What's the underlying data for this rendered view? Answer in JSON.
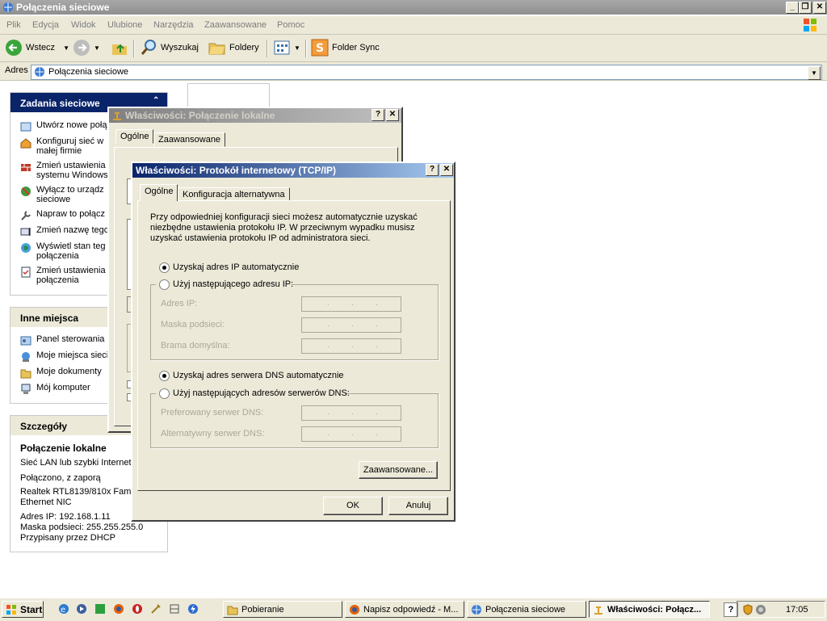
{
  "window": {
    "title": "Połączenia sieciowe"
  },
  "menu": [
    "Plik",
    "Edycja",
    "Widok",
    "Ulubione",
    "Narzędzia",
    "Zaawansowane",
    "Pomoc"
  ],
  "toolbar": {
    "back": "Wstecz",
    "search": "Wyszukaj",
    "folders": "Foldery",
    "folder_sync": "Folder Sync"
  },
  "address": {
    "label": "Adres",
    "value": "Połączenia sieciowe"
  },
  "tasks": {
    "header": "Zadania sieciowe",
    "items": [
      "Utwórz nowe połą",
      "Konfiguruj sieć w\nmałej firmie",
      "Zmień ustawienia\nsystemu Windows",
      "Wyłącz to urządz\nsieciowe",
      "Napraw to połącz",
      "Zmień nazwę tego",
      "Wyświetl stan teg\npołączenia",
      "Zmień ustawienia\npołączenia"
    ]
  },
  "other_places": {
    "header": "Inne miejsca",
    "items": [
      "Panel sterowania",
      "Moje miejsca sieci",
      "Moje dokumenty",
      "Mój komputer"
    ]
  },
  "details": {
    "header": "Szczegóły",
    "name": "Połączenie lokalne",
    "lines": [
      "Sieć LAN lub szybki Internet",
      "Połączono, z zaporą",
      "Realtek RTL8139/810x Famil\nEthernet NIC",
      "Adres IP: 192.168.1.11\nMaska podsieci: 255.255.255.0\nPrzypisany przez DHCP"
    ]
  },
  "dialog_back": {
    "title": "Właściwości: Połączenie lokalne",
    "tabs": [
      "Ogólne",
      "Zaawansowane"
    ]
  },
  "dialog": {
    "title": "Właściwości: Protokół internetowy (TCP/IP)",
    "tabs": [
      "Ogólne",
      "Konfiguracja alternatywna"
    ],
    "intro": "Przy odpowiedniej konfiguracji sieci możesz automatycznie uzyskać\nniezbędne ustawienia protokołu IP. W przeciwnym wypadku musisz\nuzyskać ustawienia protokołu IP od administratora sieci.",
    "ip_auto": "Uzyskaj adres IP automatycznie",
    "ip_manual": "Użyj następującego adresu IP:",
    "ip_fields": [
      "Adres IP:",
      "Maska podsieci:",
      "Brama domyślna:"
    ],
    "dns_auto": "Uzyskaj adres serwera DNS automatycznie",
    "dns_manual": "Użyj następujących adresów serwerów DNS:",
    "dns_fields": [
      "Preferowany serwer DNS:",
      "Alternatywny serwer DNS:"
    ],
    "advanced": "Zaawansowane...",
    "ok": "OK",
    "cancel": "Anuluj",
    "help": "?",
    "close": "✕"
  },
  "taskbar": {
    "start": "Start",
    "buttons": [
      "Pobieranie",
      "Napisz odpowiedź - M...",
      "Połączenia sieciowe",
      "Właściwości: Połącz..."
    ],
    "clock": "17:05"
  }
}
